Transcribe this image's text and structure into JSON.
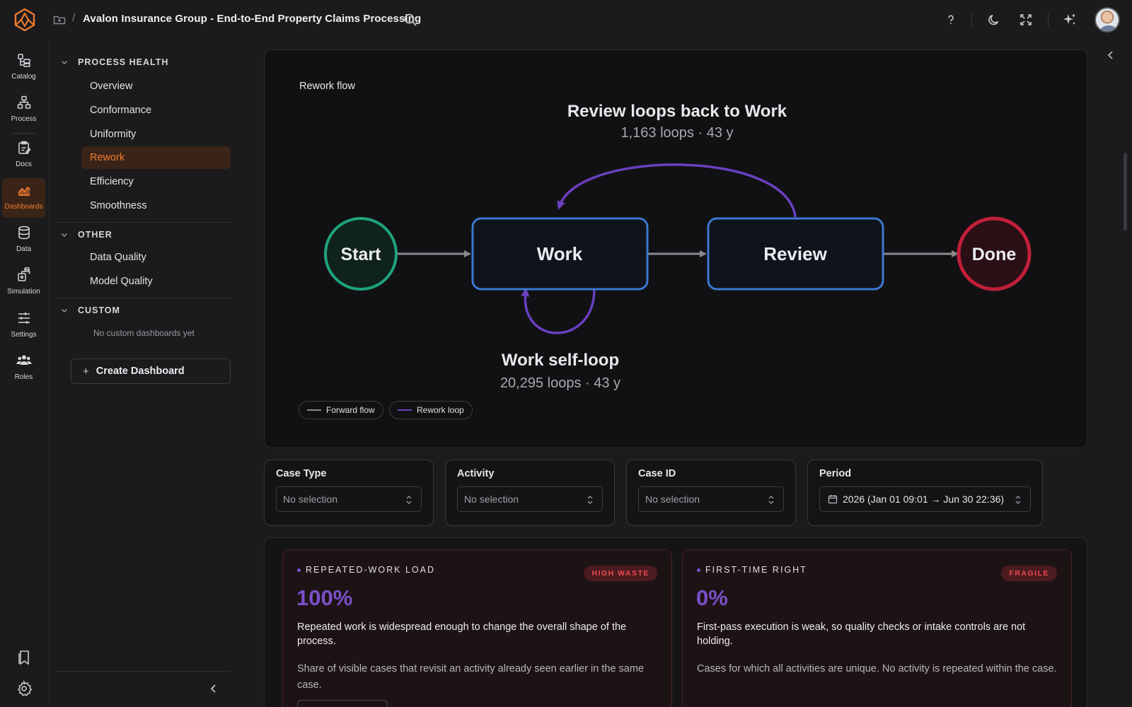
{
  "header": {
    "title": "Avalon Insurance Group - End-to-End Property Claims Processing",
    "breadcrumb_separator": "/"
  },
  "rail": {
    "items": [
      {
        "label": "Catalog",
        "icon": "catalog-icon"
      },
      {
        "label": "Process",
        "icon": "process-icon"
      },
      {
        "label": "Docs",
        "icon": "docs-icon"
      },
      {
        "label": "Dashboards",
        "icon": "dashboards-icon",
        "active": true
      },
      {
        "label": "Data",
        "icon": "database-icon"
      },
      {
        "label": "Simulation",
        "icon": "simulation-icon"
      },
      {
        "label": "Settings",
        "icon": "sliders-icon"
      },
      {
        "label": "Roles",
        "icon": "users-icon"
      }
    ]
  },
  "nav": {
    "groups": [
      {
        "title": "PROCESS HEALTH",
        "items": [
          "Overview",
          "Conformance",
          "Uniformity",
          "Rework",
          "Efficiency",
          "Smoothness"
        ],
        "active": "Rework"
      },
      {
        "title": "OTHER",
        "items": [
          "Data Quality",
          "Model Quality"
        ]
      },
      {
        "title": "CUSTOM",
        "empty_text": "No custom dashboards yet"
      }
    ],
    "create_label": "Create Dashboard"
  },
  "flow": {
    "card_title": "Rework flow",
    "top_loop": {
      "title": "Review loops back to Work",
      "stats": "1,163 loops · 43 y"
    },
    "self_loop": {
      "title": "Work self-loop",
      "stats": "20,295 loops · 43 y"
    },
    "nodes": {
      "start": "Start",
      "work": "Work",
      "review": "Review",
      "done": "Done"
    },
    "legend": {
      "forward": "Forward flow",
      "rework": "Rework loop"
    },
    "colors": {
      "start": "#1fa37c",
      "work": "#3b78d0",
      "done": "#c11f3a",
      "forward": "#8a8a8e",
      "rework": "#7b4fc9"
    }
  },
  "filters": [
    {
      "label": "Case Type",
      "value": "No selection"
    },
    {
      "label": "Activity",
      "value": "No selection"
    },
    {
      "label": "Case ID",
      "value": "No selection"
    },
    {
      "label": "Period",
      "value": "2026 (Jan 01 09:01 → Jun 30 22:36)"
    }
  ],
  "metrics": [
    {
      "eyebrow": "REPEATED-WORK LOAD",
      "badge": "HIGH WASTE",
      "value": "100%",
      "description": "Repeated work is widespread enough to change the overall shape of the process.",
      "note": "Share of visible cases that revisit an activity already seen earlier in the same case."
    },
    {
      "eyebrow": "FIRST-TIME RIGHT",
      "badge": "FRAGILE",
      "value": "0%",
      "description": "First-pass execution is weak, so quality checks or intake controls are not holding.",
      "note": "Cases for which all activities are unique. No activity is repeated within the case."
    }
  ]
}
